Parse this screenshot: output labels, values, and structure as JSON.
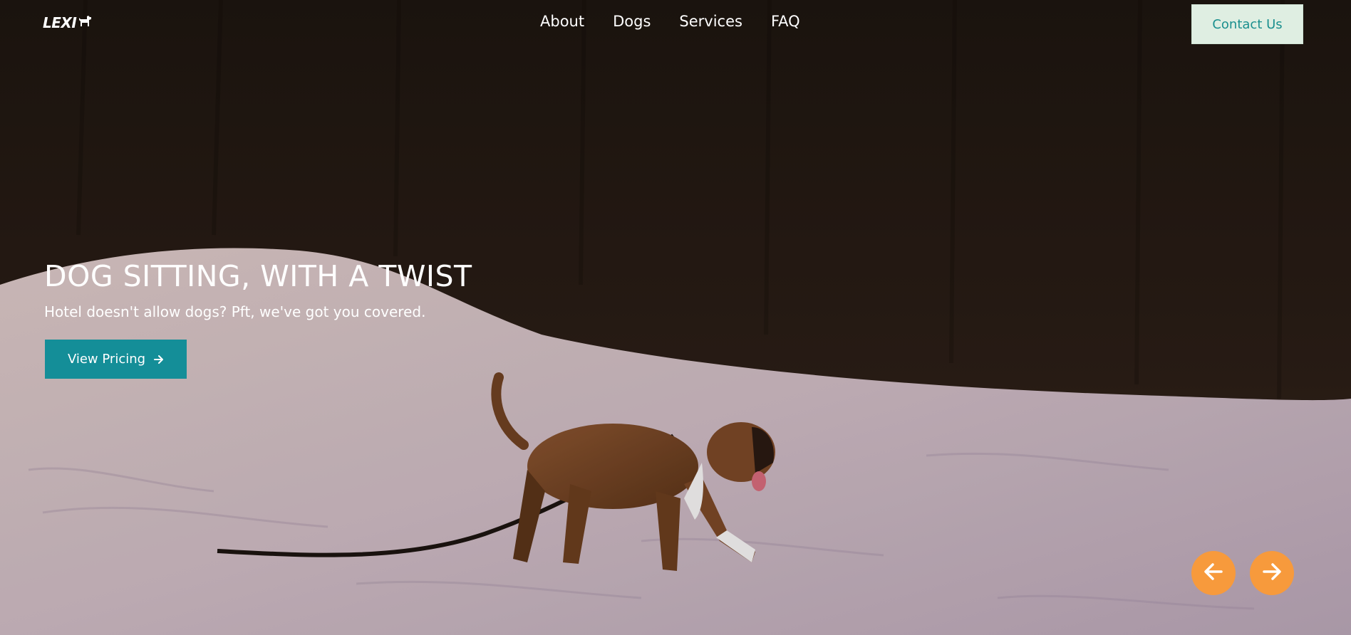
{
  "brand": {
    "logo_text": "LEXI"
  },
  "nav": {
    "items": [
      {
        "label": "About"
      },
      {
        "label": "Dogs"
      },
      {
        "label": "Services"
      },
      {
        "label": "FAQ"
      }
    ],
    "contact_label": "Contact Us"
  },
  "hero": {
    "headline": "DOG SITTING, WITH A TWIST",
    "subtext": "Hotel doesn't allow dogs? Pft, we've got you covered.",
    "cta_label": "View Pricing",
    "cta_icon": "arrow-right-icon"
  },
  "carousel": {
    "prev_icon": "arrow-left-icon",
    "next_icon": "arrow-right-icon"
  },
  "colors": {
    "cta_background": "#148e98",
    "contact_background": "#dfeee2",
    "contact_text": "#1a8f8e",
    "carousel_button": "#f79a3c"
  }
}
